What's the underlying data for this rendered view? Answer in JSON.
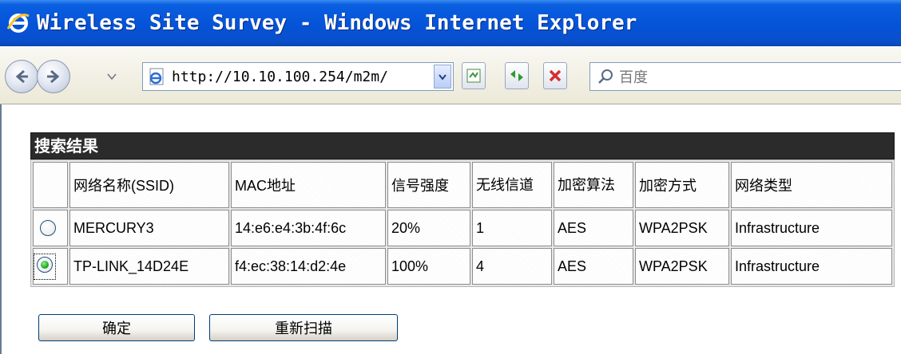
{
  "window": {
    "title": "Wireless Site Survey - Windows Internet Explorer"
  },
  "toolbar": {
    "url": "http://10.10.100.254/m2m/",
    "search_placeholder": "百度",
    "icons": [
      "back-icon",
      "forward-icon",
      "dropdown-icon",
      "page-icon",
      "compat-view-icon",
      "refresh-icon",
      "stop-icon",
      "search-icon"
    ]
  },
  "results": {
    "title": "搜索结果",
    "columns": [
      "",
      "网络名称(SSID)",
      "MAC地址",
      "信号强度",
      "无线信道",
      "加密算法",
      "加密方式",
      "网络类型"
    ],
    "rows": [
      {
        "selected": false,
        "ssid": "MERCURY3",
        "mac": "14:e6:e4:3b:4f:6c",
        "signal": "20%",
        "channel": "1",
        "algorithm": "AES",
        "auth": "WPA2PSK",
        "type": "Infrastructure"
      },
      {
        "selected": true,
        "ssid": "TP-LINK_14D24E",
        "mac": "f4:ec:38:14:d2:4e",
        "signal": "100%",
        "channel": "4",
        "algorithm": "AES",
        "auth": "WPA2PSK",
        "type": "Infrastructure"
      }
    ]
  },
  "actions": {
    "ok_label": "确定",
    "rescan_label": "重新扫描"
  },
  "colors": {
    "titlebar": "#0553d8",
    "header_bg": "#2b2b2b"
  }
}
